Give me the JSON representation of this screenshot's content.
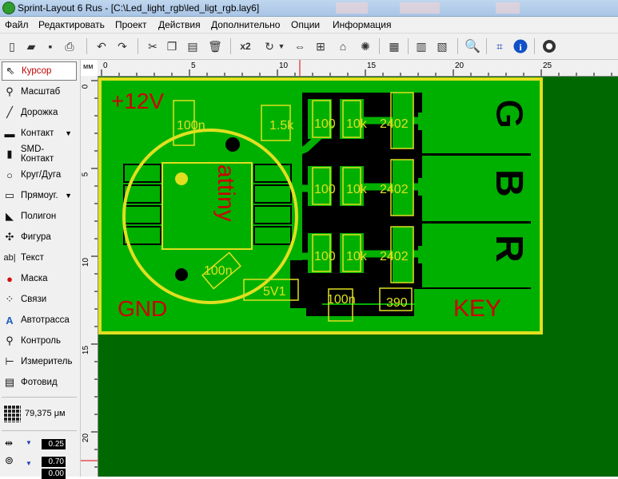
{
  "app": {
    "title": "Sprint-Layout 6 Rus - [C:\\Led_light_rgb\\led_ligt_rgb.lay6]"
  },
  "menu": [
    "Файл",
    "Редактировать",
    "Проект",
    "Действия",
    "Дополнительно",
    "Опции",
    "Информация"
  ],
  "toolbar": {
    "multiplier": "x2"
  },
  "tools": [
    {
      "label": "Курсор",
      "icon": "cursor-icon",
      "active": true
    },
    {
      "label": "Масштаб",
      "icon": "zoom-icon"
    },
    {
      "label": "Дорожка",
      "icon": "track-icon"
    },
    {
      "label": "Контакт",
      "icon": "pad-icon",
      "dropdown": true
    },
    {
      "label": "SMD-Контакт",
      "icon": "smd-pad-icon"
    },
    {
      "label": "Круг/Дуга",
      "icon": "circle-icon"
    },
    {
      "label": "Прямоуг.",
      "icon": "rectangle-icon",
      "dropdown": true
    },
    {
      "label": "Полигон",
      "icon": "polygon-icon"
    },
    {
      "label": "Фигура",
      "icon": "shape-icon"
    },
    {
      "label": "Текст",
      "icon": "text-icon"
    },
    {
      "label": "Маска",
      "icon": "mask-icon"
    },
    {
      "label": "Связи",
      "icon": "connections-icon"
    },
    {
      "label": "Автотрасса",
      "icon": "autoroute-icon"
    },
    {
      "label": "Контроль",
      "icon": "check-icon"
    },
    {
      "label": "Измеритель",
      "icon": "measure-icon"
    },
    {
      "label": "Фотовид",
      "icon": "photoview-icon"
    }
  ],
  "grid": {
    "value": "79,375 μм"
  },
  "track_width": "0.25",
  "pad_size": "0.70",
  "pad_hole": "0.00",
  "ruler": {
    "unit": "мм",
    "h_labels": [
      "0",
      "5",
      "10",
      "15",
      "20",
      "25"
    ],
    "v_labels": [
      "0",
      "5",
      "10",
      "15",
      "20"
    ]
  },
  "pcb": {
    "power_label": "+12V",
    "ground_label": "GND",
    "key_label": "KEY",
    "mcu_label": "attiny",
    "channels": [
      "G",
      "B",
      "R"
    ],
    "parts": {
      "c1": "100n",
      "r_top": "1.5k",
      "r100_1": "100",
      "r10k_1": "10k",
      "q1": "2402",
      "r100_2": "100",
      "r10k_2": "10k",
      "q2": "2402",
      "r100_3": "100",
      "r10k_3": "10k",
      "q3": "2402",
      "c2": "100n",
      "zener": "5V1",
      "c3": "100n",
      "r390": "390"
    },
    "colors": {
      "board": "#00b000",
      "background": "#006800",
      "silk": "#e0e020",
      "copper_text": "#cc0000"
    }
  }
}
